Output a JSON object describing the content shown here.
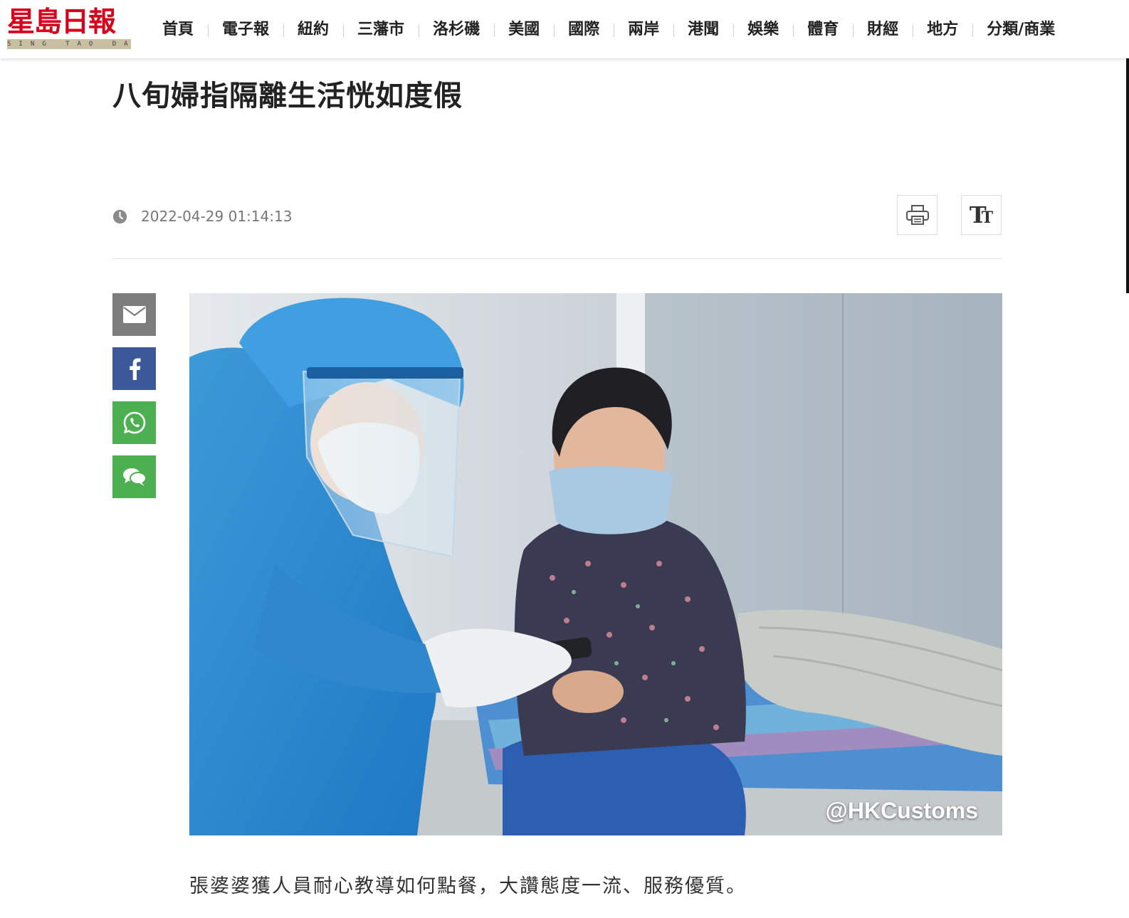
{
  "site": {
    "logo_text": "星島日報",
    "logo_subtext": "SING TAO DAILY"
  },
  "nav": {
    "items": [
      "首頁",
      "電子報",
      "紐約",
      "三藩市",
      "洛杉磯",
      "美國",
      "國際",
      "兩岸",
      "港聞",
      "娛樂",
      "體育",
      "財經",
      "地方",
      "分類/商業"
    ]
  },
  "article": {
    "title": "八旬婦指隔離生活恍如度假",
    "timestamp": "2022-04-29 01:14:13",
    "photo_watermark": "@HKCustoms",
    "caption": "張婆婆獲人員耐心教導如何點餐，大讚態度一流、服務優質。"
  },
  "toolbar": {
    "font_size_glyph": "T",
    "font_size_glyph_small": "T"
  },
  "share": {
    "email_color": "#7d7d7d",
    "facebook_color": "#3b5998",
    "whatsapp_color": "#4caf50",
    "comment_color": "#4caf50"
  },
  "theme": {
    "brand_red": "#d6001c"
  }
}
